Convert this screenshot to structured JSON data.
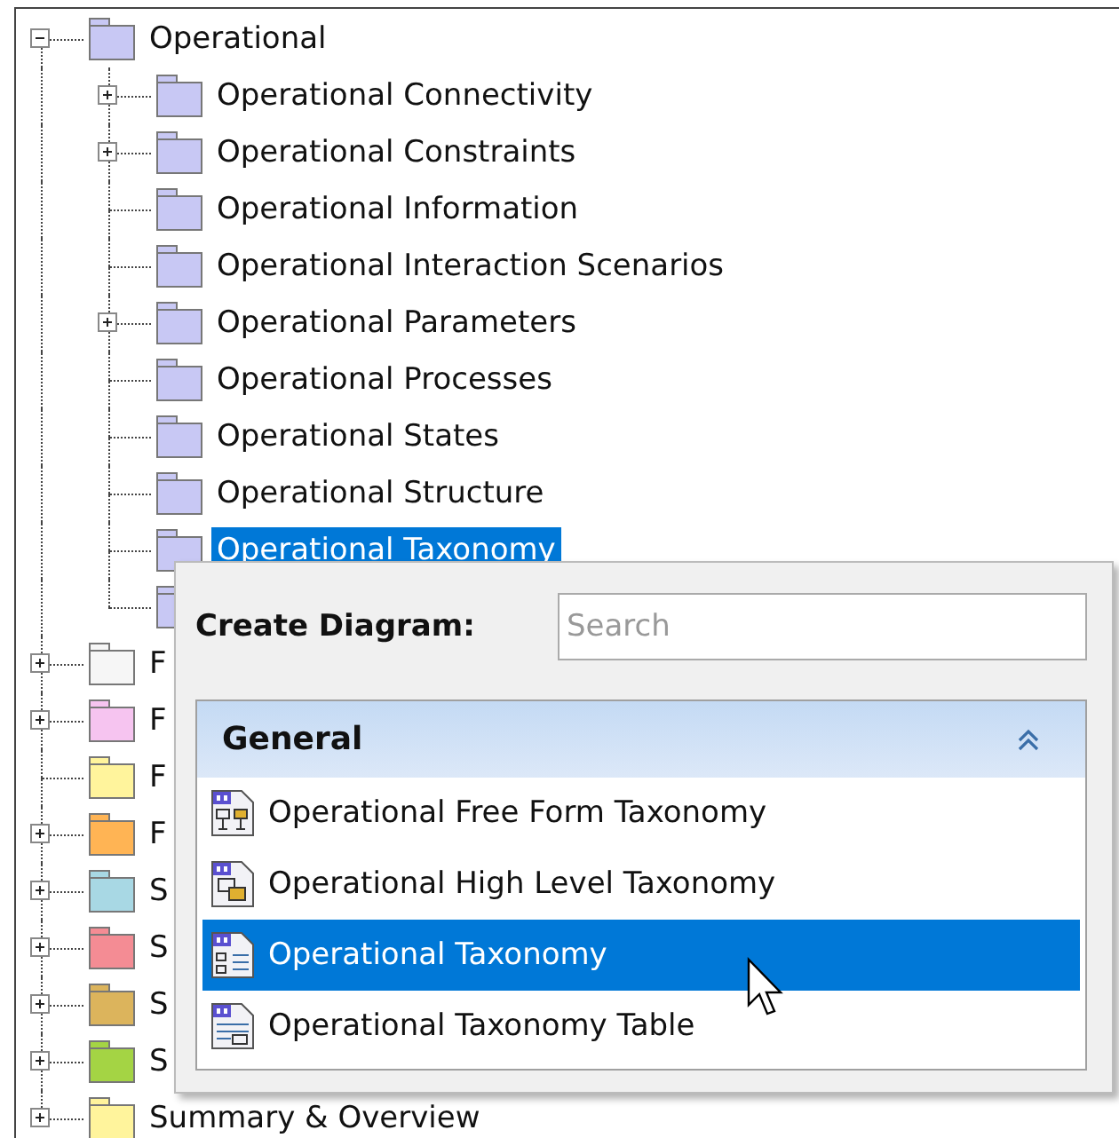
{
  "tree": {
    "items": [
      {
        "label": "Operational",
        "kind": "branch",
        "expanded": true,
        "selected": false,
        "color": "#c8c8f4",
        "children": [
          {
            "label": "Operational Connectivity",
            "kind": "branch",
            "expanded": false,
            "selected": false,
            "color": "#c8c8f4"
          },
          {
            "label": "Operational Constraints",
            "kind": "branch",
            "expanded": false,
            "selected": false,
            "color": "#c8c8f4"
          },
          {
            "label": "Operational Information",
            "kind": "leaf",
            "selected": false,
            "color": "#c8c8f4"
          },
          {
            "label": "Operational Interaction Scenarios",
            "kind": "leaf",
            "selected": false,
            "color": "#c8c8f4"
          },
          {
            "label": "Operational Parameters",
            "kind": "branch",
            "expanded": false,
            "selected": false,
            "color": "#c8c8f4"
          },
          {
            "label": "Operational Processes",
            "kind": "leaf",
            "selected": false,
            "color": "#c8c8f4"
          },
          {
            "label": "Operational States",
            "kind": "leaf",
            "selected": false,
            "color": "#c8c8f4"
          },
          {
            "label": "Operational Structure",
            "kind": "leaf",
            "selected": false,
            "color": "#c8c8f4"
          },
          {
            "label": "Operational Taxonomy",
            "kind": "leaf",
            "selected": true,
            "color": "#c8c8f4"
          },
          {
            "kind": "leaf",
            "color": "#c8c8f4"
          }
        ]
      },
      {
        "label": "F",
        "kind": "branch",
        "expanded": false,
        "selected": false,
        "color": "#f6f6f6"
      },
      {
        "label": "F",
        "kind": "branch",
        "expanded": false,
        "selected": false,
        "color": "#f6c4f0"
      },
      {
        "label": "F",
        "kind": "leaf",
        "selected": false,
        "color": "#fff49c"
      },
      {
        "label": "F",
        "kind": "branch",
        "expanded": false,
        "selected": false,
        "color": "#ffb454"
      },
      {
        "label": "S",
        "kind": "branch",
        "expanded": false,
        "selected": false,
        "color": "#a8d8e4"
      },
      {
        "label": "S",
        "kind": "branch",
        "expanded": false,
        "selected": false,
        "color": "#f48c94"
      },
      {
        "label": "S",
        "kind": "branch",
        "expanded": false,
        "selected": false,
        "color": "#dcb45c"
      },
      {
        "label": "S",
        "kind": "branch",
        "expanded": false,
        "selected": false,
        "color": "#a4d444"
      },
      {
        "label": "Summary & Overview",
        "kind": "branch",
        "expanded": false,
        "selected": false,
        "color": "#fff49c"
      }
    ]
  },
  "popup": {
    "title": "Create Diagram:",
    "search": {
      "placeholder": "Search"
    },
    "group": {
      "title": "General",
      "expanded": true,
      "items": [
        {
          "label": "Operational Free Form Taxonomy",
          "kind": "free-form",
          "selected": false
        },
        {
          "label": "Operational High Level Taxonomy",
          "kind": "high-level",
          "selected": false
        },
        {
          "label": "Operational Taxonomy",
          "kind": "taxonomy",
          "selected": true
        },
        {
          "label": "Operational Taxonomy Table",
          "kind": "table",
          "selected": false
        }
      ]
    }
  }
}
